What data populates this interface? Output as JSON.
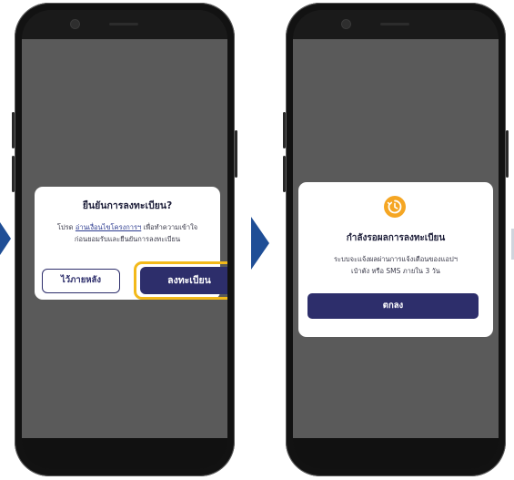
{
  "colors": {
    "brand_navy": "#2d2e6b",
    "highlight_yellow": "#f3b91a",
    "pending_orange": "#f5a623",
    "arrow_blue": "#1f4e96",
    "overlay_gray": "#5a5a5a"
  },
  "confirm_dialog": {
    "title": "ยืนยันการลงทะเบียน?",
    "line1_prefix": "โปรด",
    "line1_link": "อ่านเงื่อนไขโครงการฯ",
    "line1_suffix": "เพื่อทำความเข้าใจ",
    "line2": "ก่อนยอมรับและยืนยันการลงทะเบียน",
    "later_label": "ไว้ภายหลัง",
    "register_label": "ลงทะเบียน"
  },
  "pending_dialog": {
    "icon": "clock-pending-icon",
    "title": "กำลังรอผลการลงทะเบียน",
    "line1": "ระบบจะแจ้งผลผ่านการแจ้งเตือนของแอปฯ",
    "line2": "เป๋าตัง หรือ SMS ภายใน 3 วัน",
    "ok_label": "ตกลง"
  }
}
